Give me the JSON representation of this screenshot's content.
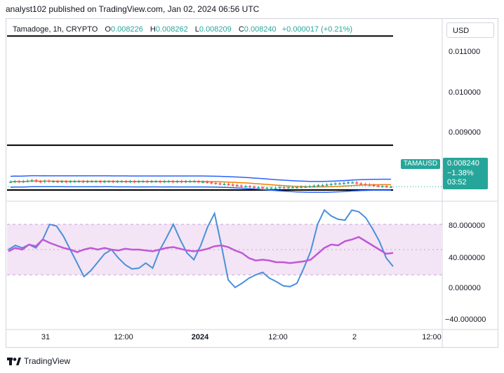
{
  "header": {
    "caption": "analyst102 published on TradingView.com, Jan 02, 2024 06:56 UTC"
  },
  "legend": {
    "symbol": "Tamadoge, 1h, CRYPTO",
    "open_label": "O",
    "open": "0.008226",
    "high_label": "H",
    "high": "0.008262",
    "low_label": "L",
    "low": "0.008209",
    "close_label": "C",
    "close": "0.008240",
    "change": "+0.000017 (+0.21%)"
  },
  "currency": "USD",
  "price_axis": [
    "0.011000",
    "0.010000",
    "0.009000"
  ],
  "price_tag": {
    "symbol": "TAMAUSD",
    "price": "0.008240",
    "change": "−1.38%",
    "countdown": "03:52"
  },
  "oscillator_axis": [
    "80.000000",
    "40.000000",
    "0.000000",
    "−40.000000"
  ],
  "time_axis": [
    {
      "label": "31",
      "bold": false
    },
    {
      "label": "12:00",
      "bold": false
    },
    {
      "label": "2024",
      "bold": true
    },
    {
      "label": "12:00",
      "bold": false
    },
    {
      "label": "2",
      "bold": false
    },
    {
      "label": "12:00",
      "bold": false
    }
  ],
  "footer": {
    "brand": "TradingView"
  },
  "colors": {
    "up": "#26a69a",
    "down": "#ef5350",
    "band": "#2962ff",
    "ma": "#f57c00",
    "stoch_k": "#4a90d9",
    "stoch_d": "#c058d6",
    "range_fill": "#f3e5f5"
  },
  "chart_data": [
    {
      "type": "line",
      "title": "",
      "description_series": [
        {
          "name": "",
          "x": [
            0,
            1,
            2,
            3,
            4,
            5,
            6,
            7,
            8,
            9,
            10,
            11,
            12,
            13,
            14,
            15,
            16,
            17,
            18,
            19,
            20,
            21,
            22,
            23,
            24,
            25,
            26,
            27,
            28,
            29,
            30,
            31,
            32,
            33,
            34,
            35,
            36,
            37,
            38,
            39,
            40,
            41,
            42,
            43,
            44,
            45,
            46,
            47,
            48,
            49,
            50,
            51,
            52,
            53,
            54,
            55,
            56,
            57,
            58,
            59,
            60,
            61,
            62,
            63,
            64,
            65,
            66,
            67,
            68,
            69,
            70,
            71,
            72,
            73,
            74,
            75,
            76,
            77,
            78,
            79,
            80,
            81,
            82,
            83,
            84,
            85,
            86,
            87,
            88,
            89
          ],
          "close": [
            0.00833,
            0.00834,
            0.00833,
            0.00834,
            0.00835,
            0.00836,
            0.00834,
            0.00833,
            0.00835,
            0.00834,
            0.00834,
            0.00833,
            0.00834,
            0.00833,
            0.00834,
            0.00834,
            0.00834,
            0.00833,
            0.00834,
            0.00834,
            0.00834,
            0.00833,
            0.00834,
            0.00834,
            0.00833,
            0.00834,
            0.00834,
            0.00833,
            0.00834,
            0.00833,
            0.00834,
            0.00834,
            0.00833,
            0.00834,
            0.00834,
            0.00833,
            0.00834,
            0.00834,
            0.00833,
            0.00834,
            0.00833,
            0.00834,
            0.00834,
            0.00834,
            0.00833,
            0.00833,
            0.00832,
            0.00831,
            0.0083,
            0.00829,
            0.00829,
            0.00828,
            0.00827,
            0.00826,
            0.00825,
            0.00825,
            0.00824,
            0.00823,
            0.00823,
            0.00822,
            0.00822,
            0.00822,
            0.00822,
            0.00823,
            0.00822,
            0.00823,
            0.00823,
            0.00823,
            0.00824,
            0.00824,
            0.00825,
            0.00826,
            0.00827,
            0.00827,
            0.00828,
            0.00829,
            0.0083,
            0.0083,
            0.00831,
            0.00832,
            0.00832,
            0.0083,
            0.00829,
            0.00828,
            0.00827,
            0.00826,
            0.00825,
            0.00825,
            0.00824,
            0.00824
          ]
        }
      ],
      "levels": [
        0.011,
        0.009,
        0.00818
      ],
      "ylim": [
        0.008,
        0.0113
      ]
    },
    {
      "type": "line",
      "title": "",
      "series": [
        {
          "name": "",
          "values": [
            50,
            55,
            52,
            56,
            52,
            62,
            80,
            78,
            66,
            50,
            34,
            18,
            25,
            35,
            45,
            50,
            40,
            32,
            27,
            28,
            34,
            28,
            49,
            64,
            80,
            62,
            46,
            38,
            55,
            77,
            93,
            55,
            14,
            5,
            10,
            16,
            20,
            23,
            16,
            12,
            7,
            6,
            10,
            28,
            48,
            80,
            97,
            90,
            86,
            85,
            97,
            95,
            88,
            75,
            60,
            40,
            30
          ]
        },
        {
          "name": "",
          "values": [
            48,
            52,
            50,
            56,
            54,
            62,
            58,
            55,
            52,
            50,
            47,
            50,
            52,
            50,
            52,
            50,
            49,
            51,
            50,
            50,
            49,
            48,
            50,
            52,
            53,
            51,
            49,
            48,
            49,
            51,
            54,
            55,
            53,
            49,
            46,
            40,
            37,
            38,
            37,
            35,
            35,
            34,
            35,
            36,
            38,
            45,
            52,
            56,
            55,
            60,
            62,
            65,
            60,
            55,
            50,
            45,
            46
          ]
        }
      ],
      "levels": [
        80,
        20
      ],
      "ylim": [
        -45,
        105
      ]
    }
  ]
}
